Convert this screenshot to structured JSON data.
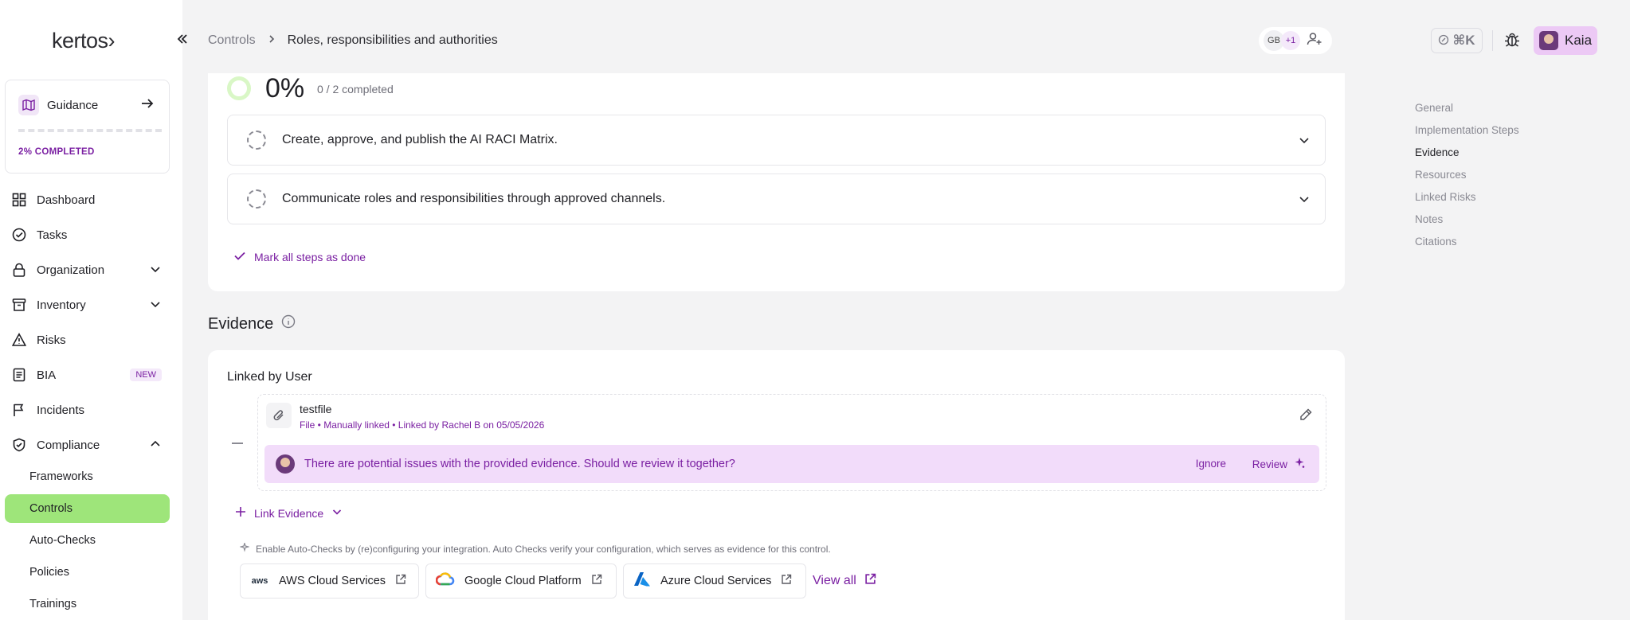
{
  "brand": {
    "logo_text": "kertos›"
  },
  "guidance": {
    "label": "Guidance",
    "progress_text": "2% COMPLETED",
    "progress_fraction": 0.02
  },
  "sidebar": {
    "items": [
      {
        "label": "Dashboard"
      },
      {
        "label": "Tasks"
      },
      {
        "label": "Organization"
      },
      {
        "label": "Inventory"
      },
      {
        "label": "Risks"
      },
      {
        "label": "BIA",
        "badge": "NEW"
      },
      {
        "label": "Incidents"
      },
      {
        "label": "Compliance"
      }
    ],
    "compliance_sub": [
      {
        "label": "Frameworks"
      },
      {
        "label": "Controls"
      },
      {
        "label": "Auto-Checks"
      },
      {
        "label": "Policies"
      },
      {
        "label": "Trainings"
      }
    ]
  },
  "header": {
    "breadcrumb_root": "Controls",
    "breadcrumb_separator": ">",
    "breadcrumb_current": "Roles, responsibilities and authorities",
    "collaborator_initials": "GB",
    "collaborator_more": "+1",
    "cmdk_label": "⌘K",
    "user_name": "Kaia"
  },
  "implementation": {
    "percent": "0%",
    "completed_text": "0 / 2 completed",
    "steps": [
      {
        "text": "Create, approve, and publish the AI RACI Matrix."
      },
      {
        "text": "Communicate roles and responsibilities through approved channels."
      }
    ],
    "mark_all": "Mark all steps as done"
  },
  "evidence": {
    "title": "Evidence",
    "linked_by_user": "Linked by User",
    "file": {
      "name": "testfile",
      "meta": "File • Manually linked • Linked by Rachel B on 05/05/2026"
    },
    "issue": {
      "message": "There are potential issues with the provided evidence. Should we review it together?",
      "ignore": "Ignore",
      "review": "Review"
    },
    "link_evidence": "Link Evidence",
    "auto_hint": "Enable Auto-Checks by (re)configuring your integration. Auto Checks verify your configuration, which serves as evidence for this control.",
    "integrations": [
      {
        "name": "AWS Cloud Services",
        "logo": "aws"
      },
      {
        "name": "Google Cloud Platform"
      },
      {
        "name": "Azure Cloud Services"
      }
    ],
    "view_all": "View all"
  },
  "toc": [
    {
      "label": "General"
    },
    {
      "label": "Implementation Steps"
    },
    {
      "label": "Evidence",
      "active": true
    },
    {
      "label": "Resources"
    },
    {
      "label": "Linked Risks"
    },
    {
      "label": "Notes"
    },
    {
      "label": "Citations"
    }
  ],
  "colors": {
    "accent": "#7a1fa2",
    "active_nav": "#9ee57a",
    "issue_bg": "#f2dcfa",
    "user_pill": "#ecc9f5"
  }
}
